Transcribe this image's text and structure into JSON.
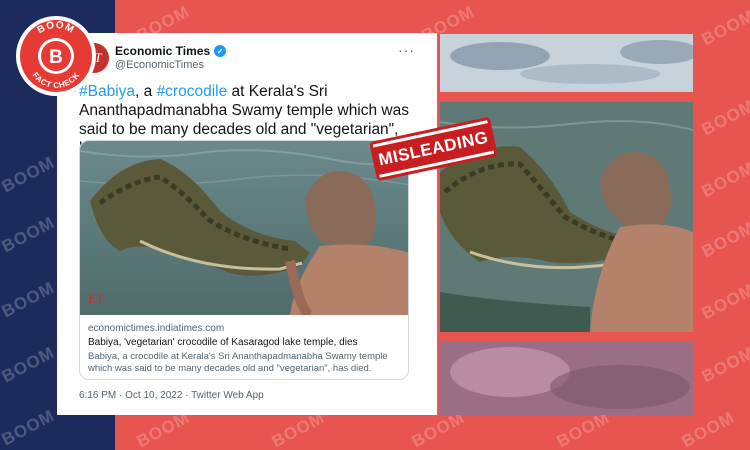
{
  "brand": {
    "watermark": "BOOM",
    "badge_top": "BOOM",
    "badge_bottom": "FACT CHECK",
    "badge_letter": "B",
    "colors": {
      "navy": "#1d2b5c",
      "red": "#e85450",
      "stamp": "#c81e22",
      "link": "#1d9bf0"
    }
  },
  "tweet": {
    "avatar_text": "ET",
    "display_name": "Economic Times",
    "handle": "@EconomicTimes",
    "more_icon": "ellipsis-icon",
    "text_parts": {
      "tag1": "#Babiya",
      "mid1": ", a ",
      "tag2": "#crocodile",
      "rest": " at Kerala's Sri Ananthapadmanabha Swamy temple which was said to be many decades old and \"vegetarian\", has died"
    },
    "card": {
      "image_logo": "ET",
      "domain": "economictimes.indiatimes.com",
      "title": "Babiya, 'vegetarian' crocodile of Kasaragod lake temple, dies",
      "description": "Babiya, a crocodile at Kerala's Sri Ananthapadmanabha Swamy temple which was said to be many decades old and \"vegetarian\", has died."
    },
    "meta": "6:16 PM · Oct 10, 2022 · Twitter Web App"
  },
  "stamp": {
    "label": "MISLEADING"
  }
}
